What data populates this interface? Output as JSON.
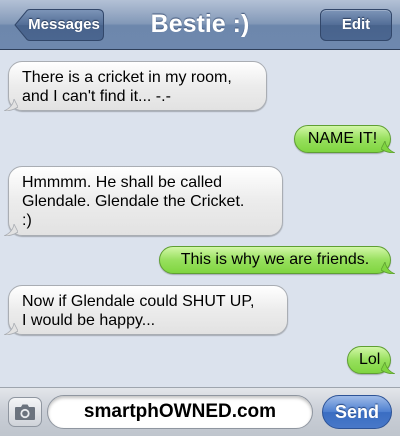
{
  "header": {
    "back_label": "Messages",
    "title": "Bestie :)",
    "edit_label": "Edit"
  },
  "messages": [
    {
      "direction": "received",
      "lines": [
        "There is a cricket in my room,",
        "and I can't find it... -.-"
      ]
    },
    {
      "direction": "sent",
      "lines": [
        "NAME IT!"
      ]
    },
    {
      "direction": "received",
      "lines": [
        "Hmmmm. He shall be called",
        "Glendale. Glendale the Cricket.",
        ":)"
      ]
    },
    {
      "direction": "sent",
      "lines": [
        "This is why we are friends."
      ]
    },
    {
      "direction": "received",
      "lines": [
        "Now if Glendale could SHUT UP,",
        "I would be happy..."
      ]
    },
    {
      "direction": "sent",
      "lines": [
        "Lol"
      ]
    }
  ],
  "composer": {
    "input_value": "smartphOWNED.com",
    "send_label": "Send"
  },
  "colors": {
    "background": "#dbe2ed",
    "received_bubble": "#e6e6e6",
    "sent_bubble": "#98e05e",
    "header": "#7f96b8",
    "send_button": "#4d7fd0"
  },
  "icons": [
    "back-arrow-icon",
    "camera-icon"
  ]
}
